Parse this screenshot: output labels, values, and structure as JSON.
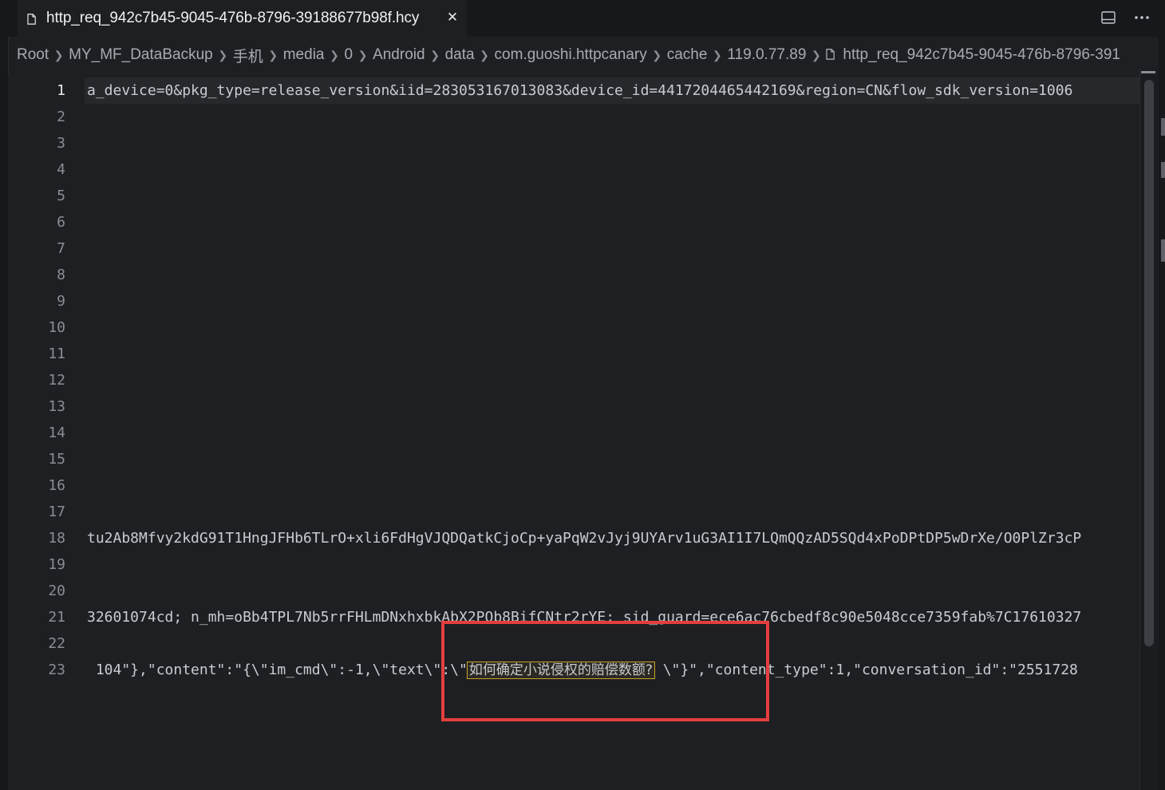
{
  "tab": {
    "title": "http_req_942c7b45-9045-476b-8796-39188677b98f.hcy",
    "file_icon": "file-icon",
    "close_icon": "close-icon"
  },
  "actions": {
    "split_icon": "split-editor-icon",
    "more_icon": "more-actions-icon"
  },
  "breadcrumb": {
    "items": [
      "Root",
      "MY_MF_DataBackup",
      "手机",
      "media",
      "0",
      "Android",
      "data",
      "com.guoshi.httpcanary",
      "cache",
      "119.0.77.89"
    ],
    "file_label": "http_req_942c7b45-9045-476b-8796-391"
  },
  "editor": {
    "line_numbers": [
      "1",
      "2",
      "3",
      "4",
      "5",
      "6",
      "7",
      "8",
      "9",
      "10",
      "11",
      "12",
      "13",
      "14",
      "15",
      "16",
      "17",
      "18",
      "19",
      "20",
      "21",
      "22",
      "23"
    ],
    "active_line": "1",
    "lines": [
      "a_device=0&pkg_type=release_version&iid=283053167013083&device_id=4417204465442169&region=CN&flow_sdk_version=1006",
      "",
      "",
      "",
      "",
      "",
      "",
      "",
      "",
      "",
      "",
      "",
      "",
      "",
      "",
      "",
      "",
      "tu2Ab8Mfvy2kdG91T1HngJFHb6TLrO+xli6FdHgVJQDQatkCjoCp+yaPqW2vJyj9UYArv1uG3AI1I7LQmQQzAD5SQd4xPoDPtDP5wDrXe/O0PlZr3cP",
      "",
      "",
      "32601074cd; n_mh=oBb4TPL7Nb5rrFHLmDNxhxbkAbX2PQb8BifCNtr2rYE; sid_guard=ece6ac76cbedf8c90e5048cce7359fab%7C17610327",
      ""
    ],
    "line23": {
      "before": " 104\"},\"content\":\"{\\\"im_cmd\\\":-1,\\\"text\\\":\\\"",
      "match": "如何确定小说侵权的赔偿数额?",
      "after": " \\\"}\",\"content_type\":1,\"conversation_id\":\"2551728"
    }
  },
  "colors": {
    "background": "#1e1f22",
    "annotation_box": "#e53e3e",
    "find_match_border": "#c9a227"
  }
}
